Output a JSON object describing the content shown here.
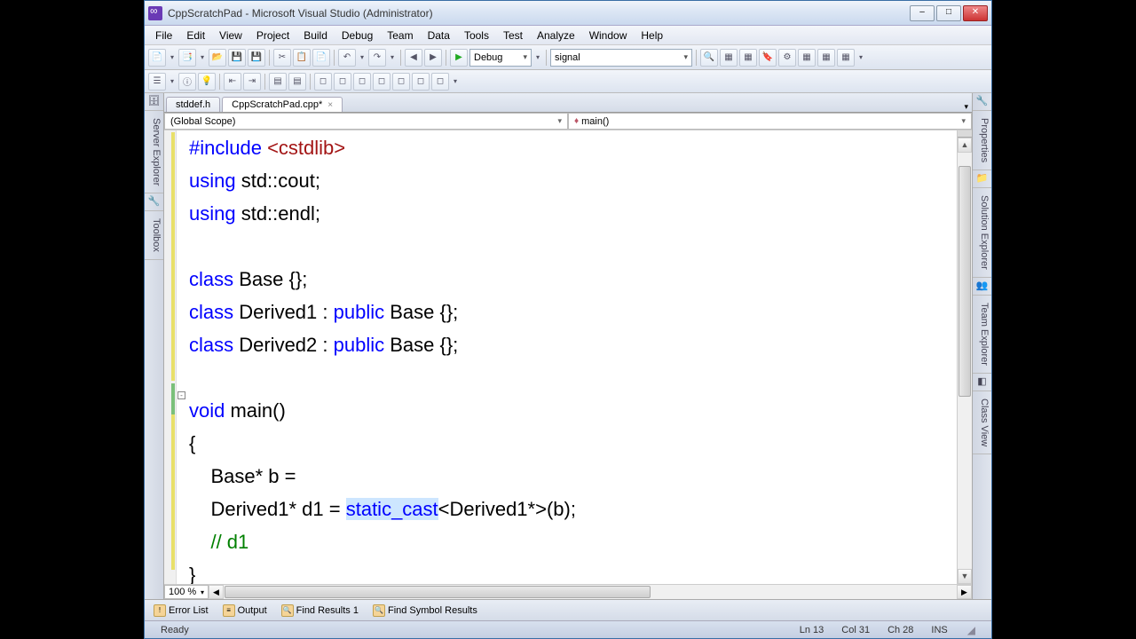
{
  "title": "CppScratchPad - Microsoft Visual Studio (Administrator)",
  "menu": [
    "File",
    "Edit",
    "View",
    "Project",
    "Build",
    "Debug",
    "Team",
    "Data",
    "Tools",
    "Test",
    "Analyze",
    "Window",
    "Help"
  ],
  "toolbar": {
    "config": "Debug",
    "find": "signal"
  },
  "sideLeft": [
    "Server Explorer",
    "Toolbox"
  ],
  "sideRight": [
    "Properties",
    "Solution Explorer",
    "Team Explorer",
    "Class View"
  ],
  "tabs": {
    "inactive": "stddef.h",
    "active": "CppScratchPad.cpp*"
  },
  "scope": {
    "left": "(Global Scope)",
    "right": "main()"
  },
  "code": {
    "l1_a": "#include ",
    "l1_b": "<cstdlib>",
    "l2_a": "using",
    "l2_b": " std::cout;",
    "l3_a": "using",
    "l3_b": " std::endl;",
    "l4": "",
    "l5_a": "class",
    "l5_b": " Base {};",
    "l6_a": "class",
    "l6_b": " Derived1 : ",
    "l6_c": "public",
    "l6_d": " Base {};",
    "l7_a": "class",
    "l7_b": " Derived2 : ",
    "l7_c": "public",
    "l7_d": " Base {};",
    "l8": "",
    "l9_a": "void",
    "l9_b": " main()",
    "l10": "{",
    "l11": "    Base* b = ",
    "l12_a": "    Derived1* d1 = ",
    "l12_b": "static_cast",
    "l12_c": "<Derived1*>(b);",
    "l13_a": "    ",
    "l13_b": "// d1",
    "l14": "}"
  },
  "zoom": "100 %",
  "bottomTabs": [
    "Error List",
    "Output",
    "Find Results 1",
    "Find Symbol Results"
  ],
  "status": {
    "ready": "Ready",
    "ln": "Ln 13",
    "col": "Col 31",
    "ch": "Ch 28",
    "ins": "INS"
  }
}
